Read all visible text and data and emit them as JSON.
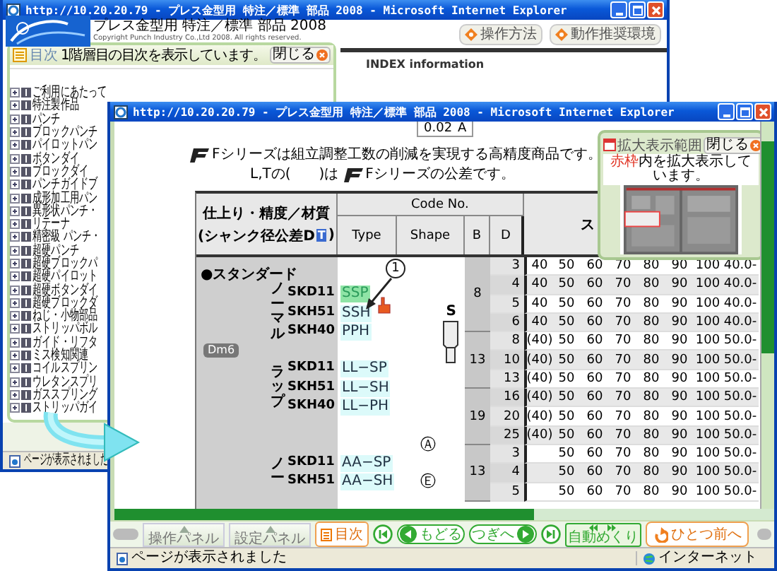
{
  "back_window": {
    "title": "http://10.20.20.79 - プレス金型用 特注／標準 部品 2008 - Microsoft Internet Explorer",
    "heading": "プレス金型用 特注／標準 部品 2008",
    "copyright": "Copyright Punch Industry Co.,Ltd 2008. All rights reserved.",
    "buttons": [
      "操作方法",
      "動作推奨環境"
    ],
    "toc": {
      "title": "目次",
      "note": "1階層目の目次を表示しています。",
      "close": "閉じる",
      "items": [
        "ご利用にあたって",
        "特注製作品",
        "パンチ",
        "ブロックパンチ",
        "パイロットパン",
        "ボタンダイ",
        "ブロックダイ",
        "パンチガイドブ",
        "成形加工用パン",
        "異形状パンチ・",
        "リテーナ",
        "精密級 パンチ・",
        "超硬パンチ",
        "超硬ブロックパ",
        "超硬パイロット",
        "超硬ボタンダイ",
        "超硬ブロックダ",
        "ねじ・小物部品",
        "ストリッパボル",
        "ガイド・リフタ",
        "ミス検知関連",
        "コイルスプリン",
        "ウレタンスプリ",
        "ガススプリング",
        "ストリッパガイ"
      ]
    },
    "index_title": "INDEX information",
    "status": "ページが表示されました"
  },
  "front_window": {
    "title": "http://10.20.20.79 - プレス金型用 特注／標準 部品 2008 - Microsoft Internet Explorer",
    "toolbar": [
      "0.02",
      "A"
    ],
    "intro": [
      {
        "parts": [
          {
            "kind": "logo"
          },
          {
            "kind": "text",
            "text": "Fシリーズは組立調整工数の削減を実現する高精度商品です。"
          }
        ]
      },
      {
        "parts": [
          {
            "kind": "text",
            "text": "L,Tの(　　)は"
          },
          {
            "kind": "logo"
          },
          {
            "kind": "text",
            "text": "Fシリーズの公差です。"
          }
        ]
      }
    ],
    "table": {
      "spec_title": "仕上り・精度／材質",
      "spec_sub": "(シャンク径公差D",
      "spec_mark": "T",
      "spec_end": ")",
      "code_no": "Code No.",
      "columns": [
        "Type",
        "Shape",
        "B",
        "D"
      ],
      "size_header": "ス",
      "section": "●スタンダード",
      "tolerance": "Dm6",
      "groups": [
        {
          "finish": "ノーマル",
          "rows": [
            {
              "material": "SKD11",
              "type": "SSP",
              "selected": true
            },
            {
              "material": "SKH51",
              "type": "SSH",
              "selected": false
            },
            {
              "material": "SKH40",
              "type": "PPH",
              "selected": false
            }
          ]
        },
        {
          "finish": "ラップ",
          "rows": [
            {
              "material": "SKD11",
              "type": "LL−SP",
              "selected": false
            },
            {
              "material": "SKH51",
              "type": "LL−SH",
              "selected": false
            },
            {
              "material": "SKH40",
              "type": "LL−PH",
              "selected": false
            }
          ]
        },
        {
          "finish": "ノー",
          "rows": [
            {
              "material": "SKD11",
              "type": "AA−SP",
              "selected": false
            },
            {
              "material": "SKH51",
              "type": "AA−SH",
              "selected": false
            }
          ]
        }
      ],
      "shapes": [
        {
          "kind": "punch",
          "label": "S"
        },
        {
          "kind": "circled",
          "label": "Ⓐ"
        },
        {
          "kind": "circled",
          "label": "Ⓔ"
        }
      ],
      "b_groups": [
        {
          "b": "8",
          "rows": [
            {
              "d": "3",
              "values": [
                "40",
                "50",
                "60",
                "70",
                "80",
                "90",
                "100",
                "40.0-"
              ]
            },
            {
              "d": "4",
              "values": [
                "40",
                "50",
                "60",
                "70",
                "80",
                "90",
                "100",
                "40.0-"
              ]
            },
            {
              "d": "5",
              "values": [
                "40",
                "50",
                "60",
                "70",
                "80",
                "90",
                "100",
                "40.0-"
              ]
            },
            {
              "d": "6",
              "values": [
                "40",
                "50",
                "60",
                "70",
                "80",
                "90",
                "100",
                "40.0-"
              ]
            }
          ]
        },
        {
          "b": "13",
          "rows": [
            {
              "d": "8",
              "values": [
                "(40)",
                "50",
                "60",
                "70",
                "80",
                "90",
                "100",
                "50.0-"
              ]
            },
            {
              "d": "10",
              "values": [
                "(40)",
                "50",
                "60",
                "70",
                "80",
                "90",
                "100",
                "50.0-"
              ]
            },
            {
              "d": "13",
              "values": [
                "(40)",
                "50",
                "60",
                "70",
                "80",
                "90",
                "100",
                "50.0-"
              ]
            }
          ]
        },
        {
          "b": "19",
          "rows": [
            {
              "d": "16",
              "values": [
                "(40)",
                "50",
                "60",
                "70",
                "80",
                "90",
                "100",
                "50.0-"
              ]
            },
            {
              "d": "20",
              "values": [
                "(40)",
                "50",
                "60",
                "70",
                "80",
                "90",
                "100",
                "50.0-"
              ]
            },
            {
              "d": "25",
              "values": [
                "(40)",
                "50",
                "60",
                "70",
                "80",
                "90",
                "100",
                "50.0-"
              ]
            }
          ]
        },
        {
          "b": "13",
          "rows": [
            {
              "d": "3",
              "values": [
                "50",
                "60",
                "70",
                "80",
                "90",
                "100",
                "50.0-"
              ]
            },
            {
              "d": "4",
              "values": [
                "50",
                "60",
                "70",
                "80",
                "90",
                "100",
                "50.0-"
              ]
            },
            {
              "d": "5",
              "values": [
                "50",
                "60",
                "70",
                "80",
                "90",
                "100",
                "50.0-"
              ]
            }
          ]
        }
      ]
    },
    "callout": "1",
    "zoom_panel": {
      "title": "拡大表示範囲",
      "close": "閉じる",
      "note_mark": "赤枠",
      "note": "内を拡大表示しています。"
    },
    "nav": {
      "panels": [
        "操作パネル",
        "設定パネル"
      ],
      "toc": "目次",
      "back": "もどる",
      "next": "つぎへ",
      "auto": "自動めくり",
      "previous": "ひとつ前へ"
    },
    "status": "ページが表示されました",
    "zone": "インターネット"
  }
}
